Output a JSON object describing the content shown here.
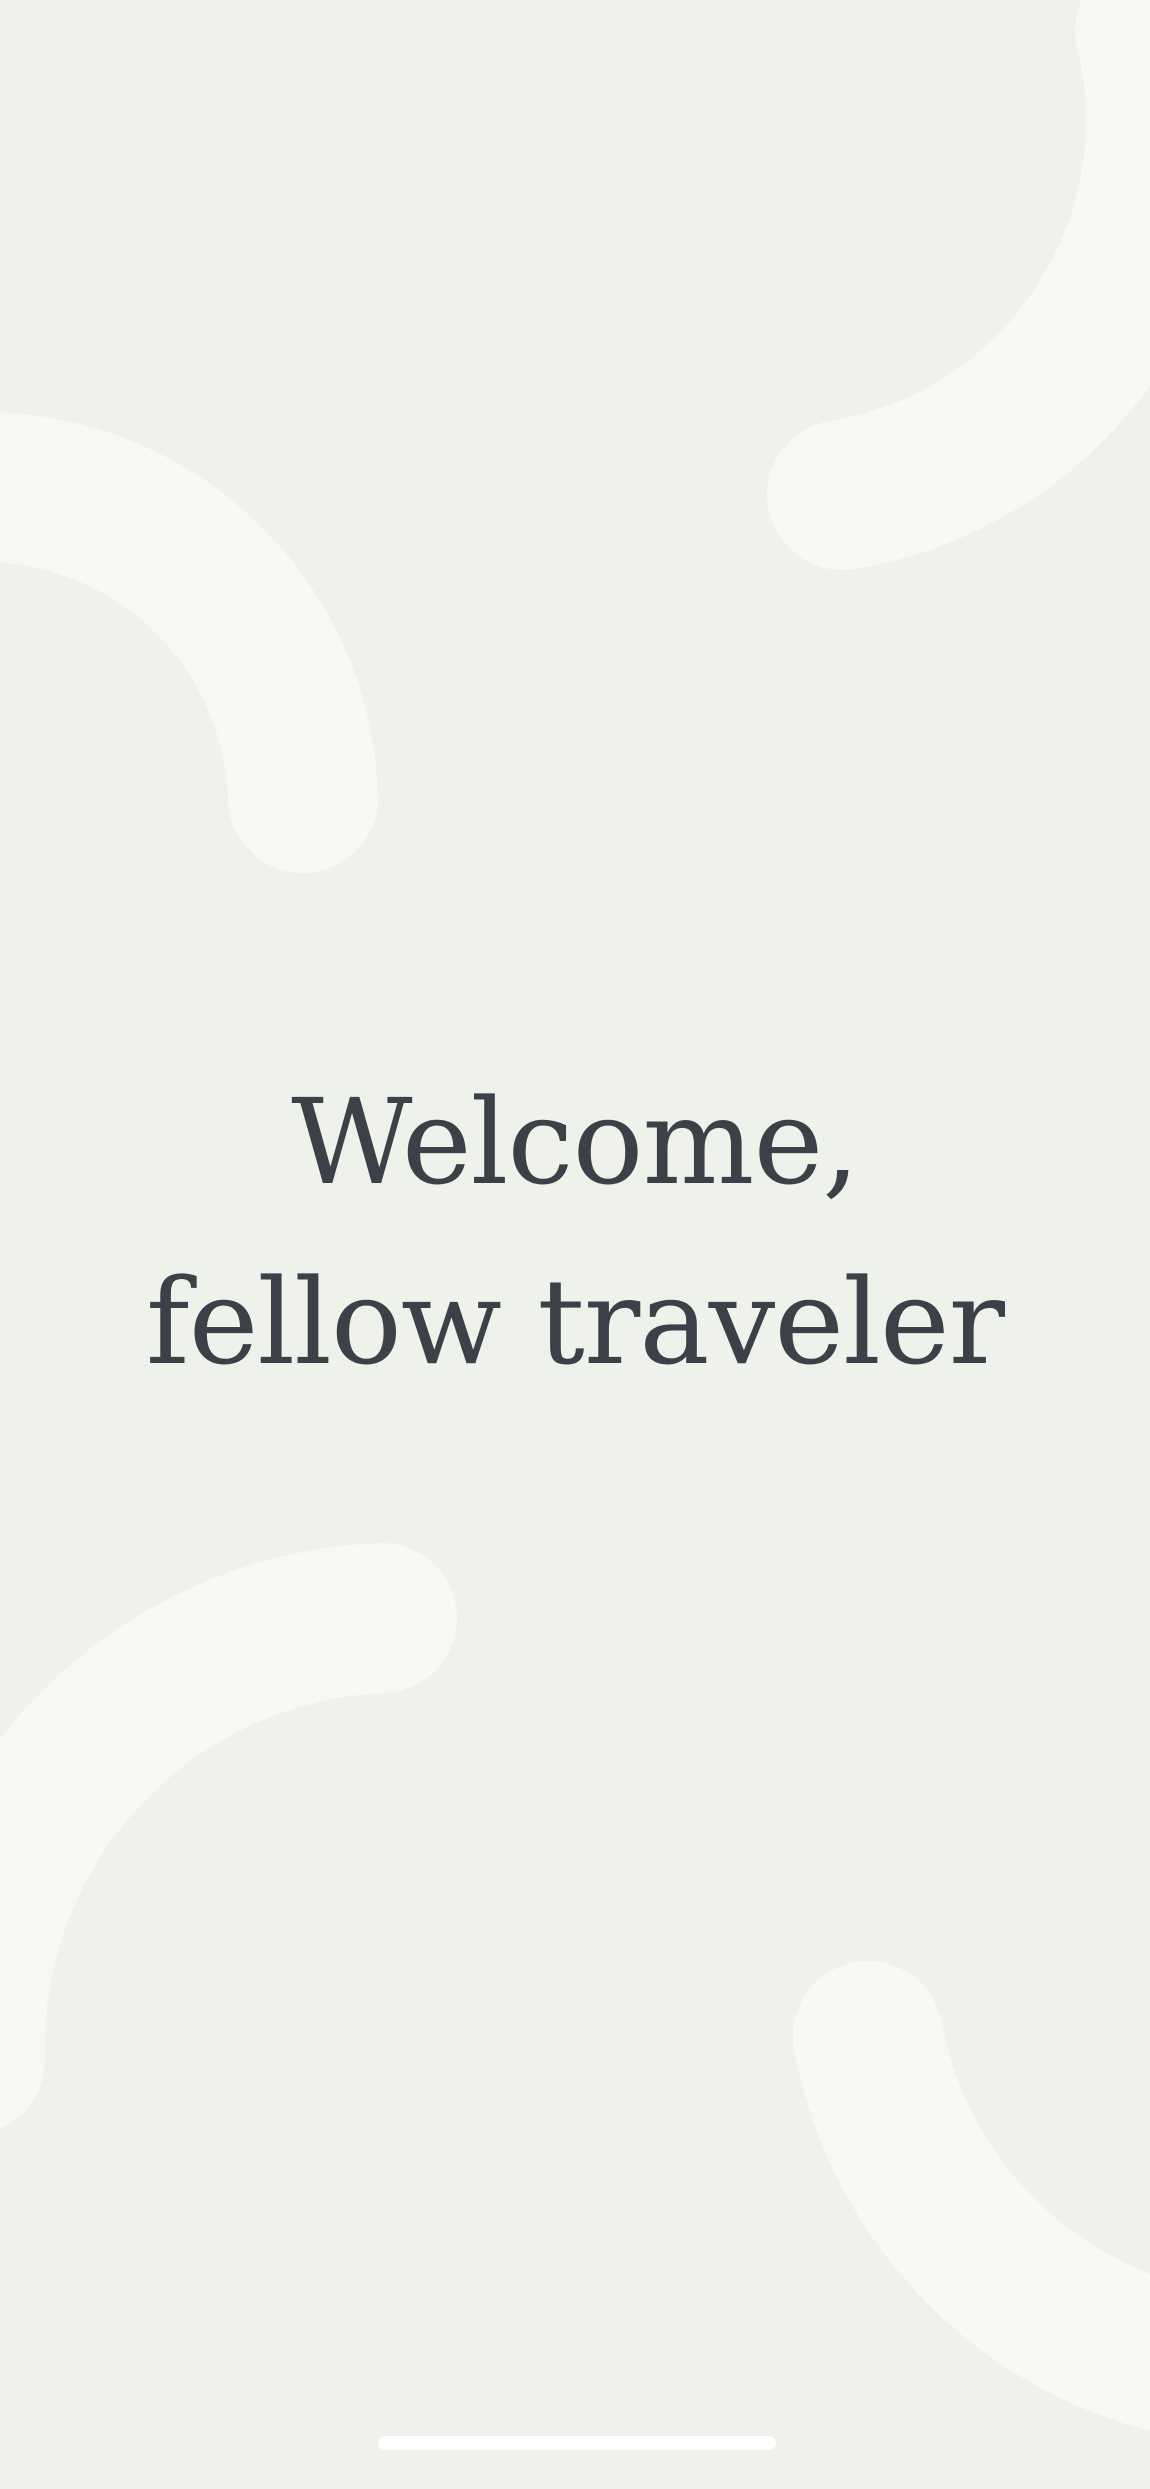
{
  "screen": {
    "background_color": "#EEF2EA",
    "decoration_color": "#F8F8F4",
    "text_color": "#3D4048"
  },
  "welcome": {
    "line1": "Welcome,",
    "line2": "fellow traveler"
  },
  "home_indicator": {
    "icon": "home-indicator-bar"
  }
}
